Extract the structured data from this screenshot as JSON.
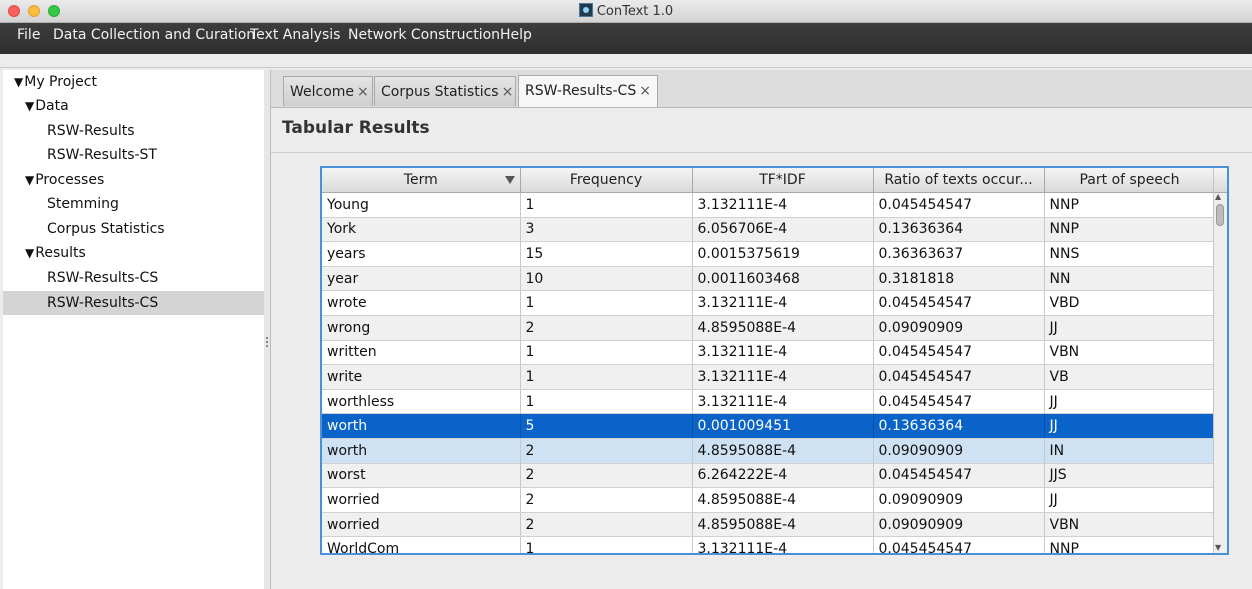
{
  "window": {
    "title": "ConText 1.0"
  },
  "menu": [
    "File",
    "Data Collection and Curation",
    "Text Analysis",
    "Network Construction",
    "Help"
  ],
  "tree": [
    {
      "label": "My Project",
      "level": 0,
      "expanded": true
    },
    {
      "label": "Data",
      "level": 1,
      "expanded": true
    },
    {
      "label": "RSW-Results",
      "level": 2
    },
    {
      "label": "RSW-Results-ST",
      "level": 2
    },
    {
      "label": "Processes",
      "level": 1,
      "expanded": true
    },
    {
      "label": "Stemming",
      "level": 2
    },
    {
      "label": "Corpus Statistics",
      "level": 2
    },
    {
      "label": "Results",
      "level": 1,
      "expanded": true
    },
    {
      "label": "RSW-Results-CS",
      "level": 2
    },
    {
      "label": "RSW-Results-CS",
      "level": 2,
      "selected": true
    }
  ],
  "tabs": [
    {
      "label": "Welcome",
      "close": "×"
    },
    {
      "label": "Corpus Statistics",
      "close": "×"
    },
    {
      "label": "RSW-Results-CS",
      "close": "×",
      "active": true
    }
  ],
  "section_title": "Tabular Results",
  "table": {
    "columns": [
      "Term",
      "Frequency",
      "TF*IDF",
      "Ratio of texts occur...",
      "Part of speech"
    ],
    "rows": [
      [
        "Young",
        "1",
        "3.132111E-4",
        "0.045454547",
        "NNP"
      ],
      [
        "York",
        "3",
        "6.056706E-4",
        "0.13636364",
        "NNP"
      ],
      [
        "years",
        "15",
        "0.0015375619",
        "0.36363637",
        "NNS"
      ],
      [
        "year",
        "10",
        "0.0011603468",
        "0.3181818",
        "NN"
      ],
      [
        "wrote",
        "1",
        "3.132111E-4",
        "0.045454547",
        "VBD"
      ],
      [
        "wrong",
        "2",
        "4.8595088E-4",
        "0.09090909",
        "JJ"
      ],
      [
        "written",
        "1",
        "3.132111E-4",
        "0.045454547",
        "VBN"
      ],
      [
        "write",
        "1",
        "3.132111E-4",
        "0.045454547",
        "VB"
      ],
      [
        "worthless",
        "1",
        "3.132111E-4",
        "0.045454547",
        "JJ"
      ],
      [
        "worth",
        "5",
        "0.001009451",
        "0.13636364",
        "JJ"
      ],
      [
        "worth",
        "2",
        "4.8595088E-4",
        "0.09090909",
        "IN"
      ],
      [
        "worst",
        "2",
        "6.264222E-4",
        "0.045454547",
        "JJS"
      ],
      [
        "worried",
        "2",
        "4.8595088E-4",
        "0.09090909",
        "JJ"
      ],
      [
        "worried",
        "2",
        "4.8595088E-4",
        "0.09090909",
        "VBN"
      ],
      [
        "WorldCom",
        "1",
        "3.132111E-4",
        "0.045454547",
        "NNP"
      ]
    ],
    "selected_row": 9,
    "lead_row": 10
  },
  "colors": {
    "selection": "#0a63c9",
    "focus_border": "#4a90d9",
    "menubar": "#333333"
  }
}
